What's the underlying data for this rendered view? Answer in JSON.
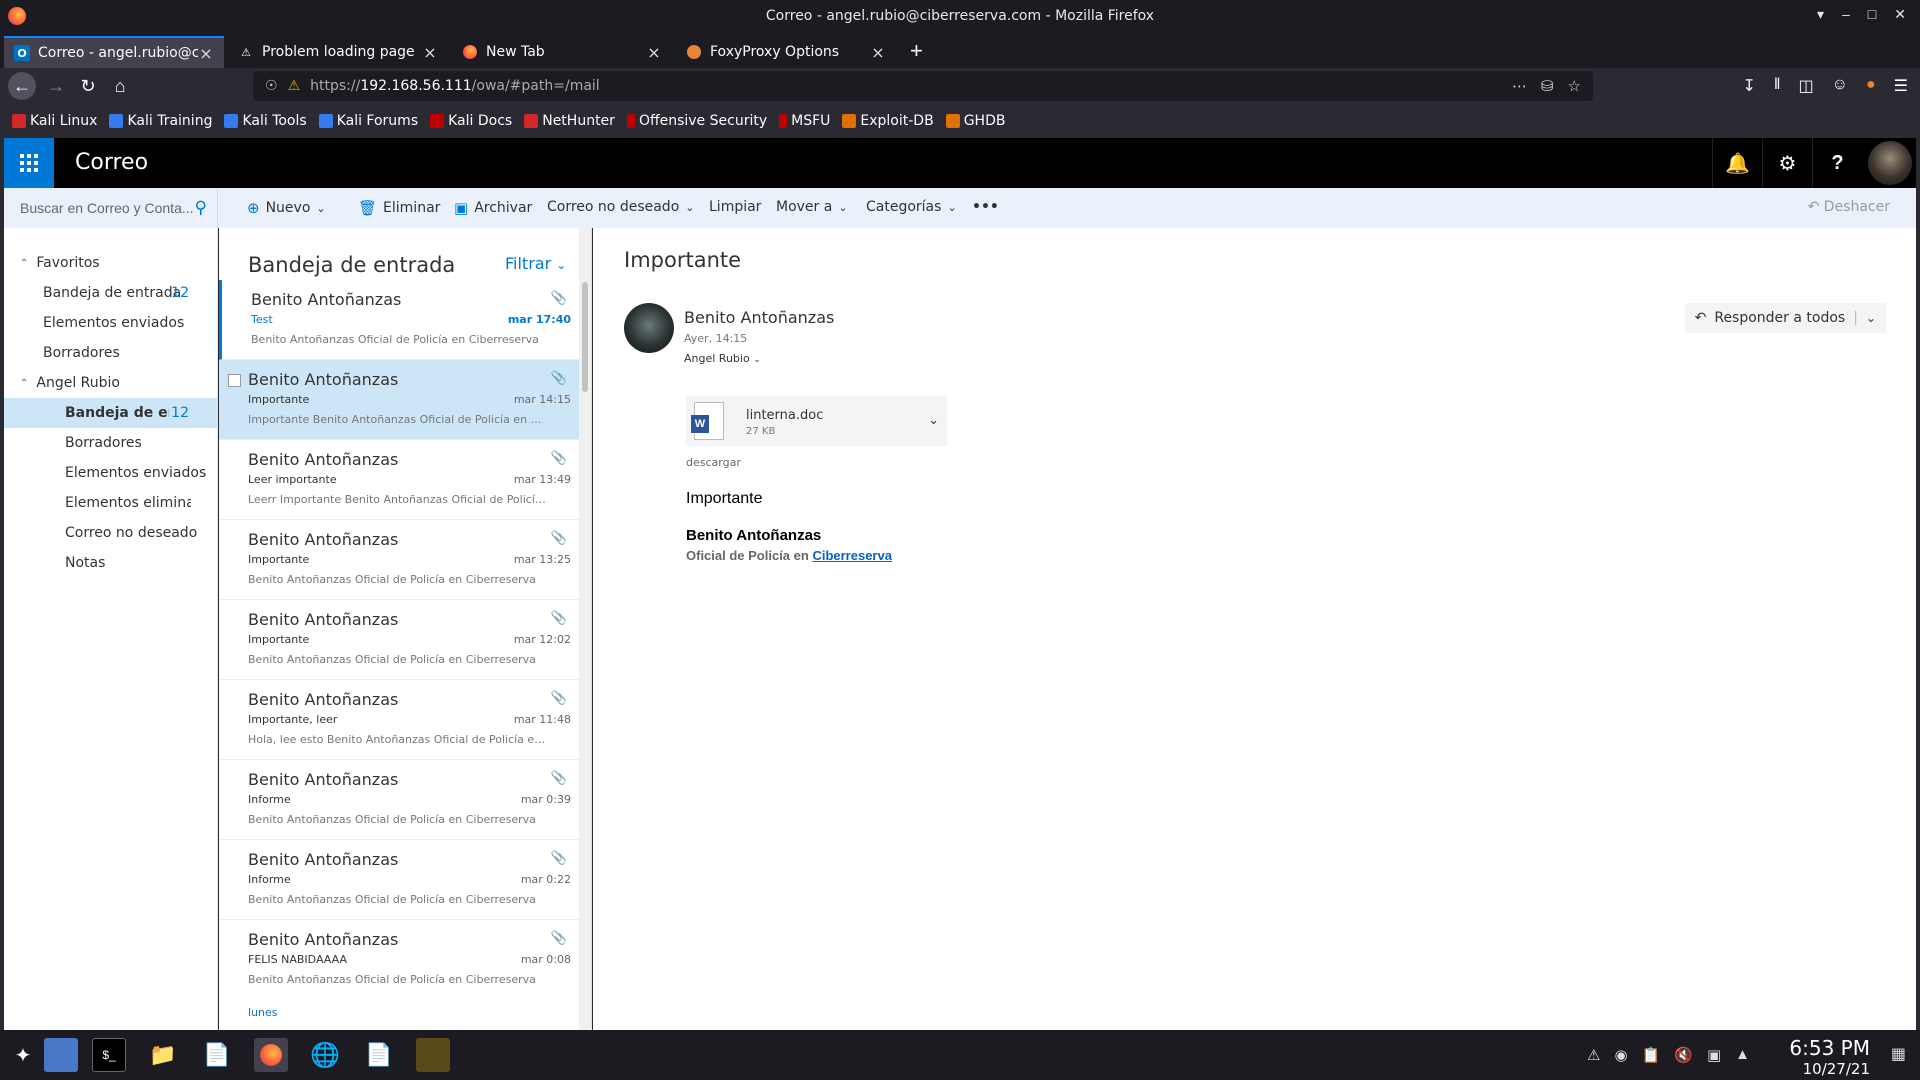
{
  "window": {
    "title": "Correo - angel.rubio@ciberreserva.com - Mozilla Firefox"
  },
  "tabs": [
    {
      "label": "Correo - angel.rubio@ciberreserva.com",
      "active": true,
      "icon": "outlook-icon"
    },
    {
      "label": "Problem loading page",
      "active": false,
      "icon": "warning-icon"
    },
    {
      "label": "New Tab",
      "active": false,
      "icon": "firefox-icon"
    },
    {
      "label": "FoxyProxy Options",
      "active": false,
      "icon": "foxyproxy-icon"
    }
  ],
  "nav": {
    "url_prefix": "https://",
    "url_host": "192.168.56.111",
    "url_path": "/owa/#path=/mail"
  },
  "bookmarks": [
    {
      "label": "Kali Linux",
      "color": "#d62728"
    },
    {
      "label": "Kali Training",
      "color": "#367bf0"
    },
    {
      "label": "Kali Tools",
      "color": "#367bf0"
    },
    {
      "label": "Kali Forums",
      "color": "#367bf0"
    },
    {
      "label": "Kali Docs",
      "color": "#c00000"
    },
    {
      "label": "NetHunter",
      "color": "#d62728"
    },
    {
      "label": "Offensive Security",
      "color": "#c00000"
    },
    {
      "label": "MSFU",
      "color": "#c00000"
    },
    {
      "label": "Exploit-DB",
      "color": "#e07000"
    },
    {
      "label": "GHDB",
      "color": "#e07000"
    }
  ],
  "owa": {
    "app_name": "Correo",
    "search_placeholder": "Buscar en Correo y Conta...",
    "commands": {
      "new": "Nuevo",
      "delete": "Eliminar",
      "archive": "Archivar",
      "junk": "Correo no deseado",
      "sweep": "Limpiar",
      "move": "Mover a",
      "categories": "Categorías",
      "undo": "Deshacer"
    },
    "folders": {
      "favorites_label": "Favoritos",
      "favorites": [
        {
          "label": "Bandeja de entrada",
          "count": "12"
        },
        {
          "label": "Elementos enviados",
          "count": ""
        },
        {
          "label": "Borradores",
          "count": ""
        }
      ],
      "account_label": "Angel Rubio",
      "account": [
        {
          "label": "Bandeja de entrada",
          "count": "12",
          "selected": true
        },
        {
          "label": "Borradores",
          "count": ""
        },
        {
          "label": "Elementos enviados",
          "count": ""
        },
        {
          "label": "Elementos eliminados",
          "count": ""
        },
        {
          "label": "Correo no deseado",
          "count": ""
        },
        {
          "label": "Notas",
          "count": ""
        }
      ]
    },
    "list": {
      "heading": "Bandeja de entrada",
      "filter": "Filtrar",
      "messages": [
        {
          "from": "Benito Antoñanzas",
          "subject": "Test",
          "date": "mar 17:40",
          "preview": "Benito Antoñanzas Oficial de Policía en Ciberreserva",
          "unread": true,
          "selected": false
        },
        {
          "from": "Benito Antoñanzas",
          "subject": "Importante",
          "date": "mar 14:15",
          "preview": "Importante Benito Antoñanzas Oficial de Policía en Ciberreserva",
          "unread": false,
          "selected": true
        },
        {
          "from": "Benito Antoñanzas",
          "subject": "Leer importante",
          "date": "mar 13:49",
          "preview": "Leerr Importante Benito Antoñanzas Oficial de Policía en Ciberreserva",
          "unread": false,
          "selected": false
        },
        {
          "from": "Benito Antoñanzas",
          "subject": "Importante",
          "date": "mar 13:25",
          "preview": "Benito Antoñanzas Oficial de Policía en Ciberreserva",
          "unread": false,
          "selected": false
        },
        {
          "from": "Benito Antoñanzas",
          "subject": "Importante",
          "date": "mar 12:02",
          "preview": "Benito Antoñanzas Oficial de Policía en Ciberreserva",
          "unread": false,
          "selected": false
        },
        {
          "from": "Benito Antoñanzas",
          "subject": "Importante, leer",
          "date": "mar 11:48",
          "preview": "Hola, lee esto Benito Antoñanzas Oficial de Policía en Ciberreserva",
          "unread": false,
          "selected": false
        },
        {
          "from": "Benito Antoñanzas",
          "subject": "Informe",
          "date": "mar 0:39",
          "preview": "Benito Antoñanzas Oficial de Policía en Ciberreserva",
          "unread": false,
          "selected": false
        },
        {
          "from": "Benito Antoñanzas",
          "subject": "Informe",
          "date": "mar 0:22",
          "preview": "Benito Antoñanzas Oficial de Policía en Ciberreserva",
          "unread": false,
          "selected": false
        },
        {
          "from": "Benito Antoñanzas",
          "subject": "FELIS NABIDAAAA",
          "date": "mar 0:08",
          "preview": "Benito Antoñanzas Oficial de Policía en Ciberreserva",
          "unread": false,
          "selected": false
        }
      ],
      "next_day_label": "lunes"
    },
    "reading": {
      "subject": "Importante",
      "from": "Benito Antoñanzas",
      "date": "Ayer, 14:15",
      "to": "Angel Rubio",
      "reply_all": "Responder a todos",
      "attachment": {
        "name": "linterna.doc",
        "size": "27 KB"
      },
      "download": "descargar",
      "body": "Importante",
      "signature_name": "Benito Antoñanzas",
      "signature_role": "Oficial de Policía en",
      "signature_org": "Ciberreserva"
    }
  },
  "taskbar": {
    "time": "6:53 PM",
    "date": "10/27/21"
  }
}
